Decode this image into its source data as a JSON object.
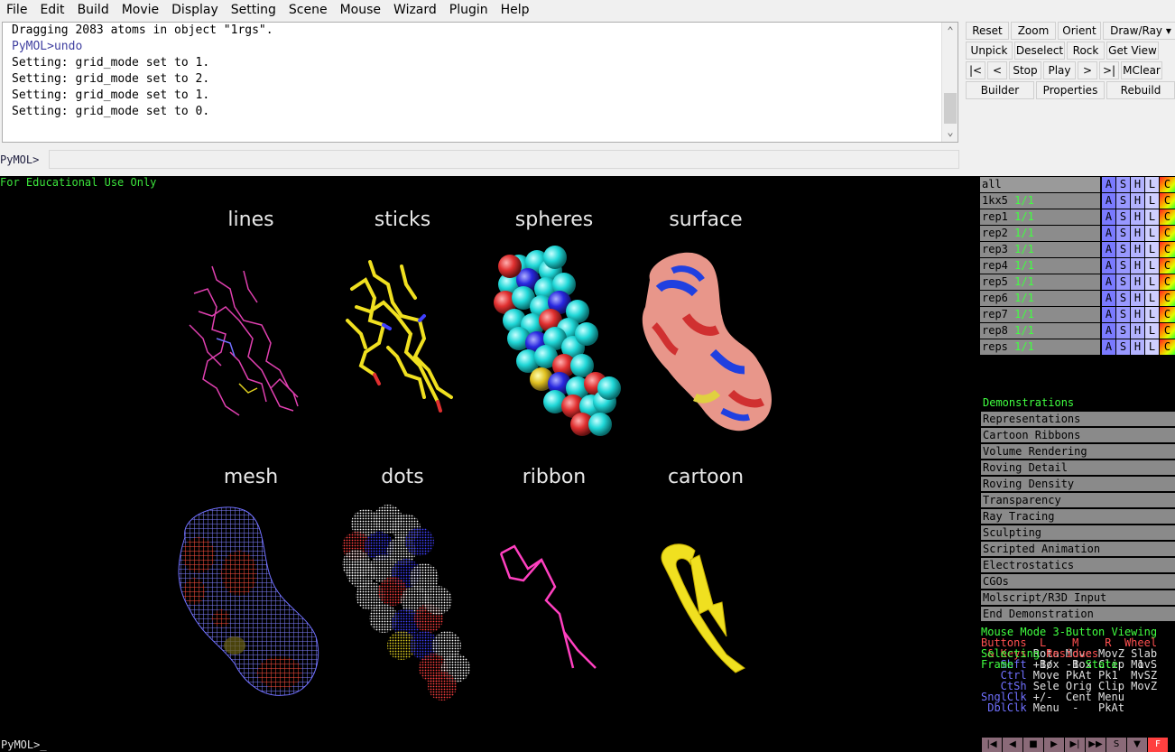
{
  "menubar": {
    "items": [
      "File",
      "Edit",
      "Build",
      "Movie",
      "Display",
      "Setting",
      "Scene",
      "Mouse",
      "Wizard",
      "Plugin",
      "Help"
    ]
  },
  "log": {
    "lines": [
      {
        "text": "Dragging 2083 atoms in object \"1rgs\".",
        "prompt": false
      },
      {
        "text": "PyMOL>undo",
        "prompt": true
      },
      {
        "text": "Setting: grid_mode set to 1.",
        "prompt": false
      },
      {
        "text": "Setting: grid_mode set to 2.",
        "prompt": false
      },
      {
        "text": "Setting: grid_mode set to 1.",
        "prompt": false
      },
      {
        "text": "Setting: grid_mode set to 0.",
        "prompt": false
      }
    ],
    "scroll_up_icon": "triangle-up",
    "scroll_down_icon": "triangle-down"
  },
  "command": {
    "label": "PyMOL>",
    "value": ""
  },
  "buttons": {
    "row1": [
      "Reset",
      "Zoom",
      "Orient",
      "Draw/Ray ▾"
    ],
    "row2": [
      "Unpick",
      "Deselect",
      "Rock",
      "Get View"
    ],
    "row3": [
      "|<",
      "<",
      "Stop",
      "Play",
      ">",
      ">|",
      "MClear"
    ],
    "row4": [
      "Builder",
      "Properties",
      "Rebuild"
    ]
  },
  "viewport": {
    "watermark": "For Educational Use Only",
    "labels": [
      "lines",
      "sticks",
      "spheres",
      "surface",
      "mesh",
      "dots",
      "ribbon",
      "cartoon"
    ]
  },
  "objects": [
    {
      "name": "all",
      "state": ""
    },
    {
      "name": "1kx5",
      "state": "1/1"
    },
    {
      "name": "rep1",
      "state": "1/1"
    },
    {
      "name": "rep2",
      "state": "1/1"
    },
    {
      "name": "rep3",
      "state": "1/1"
    },
    {
      "name": "rep4",
      "state": "1/1"
    },
    {
      "name": "rep5",
      "state": "1/1"
    },
    {
      "name": "rep6",
      "state": "1/1"
    },
    {
      "name": "rep7",
      "state": "1/1"
    },
    {
      "name": "rep8",
      "state": "1/1"
    },
    {
      "name": "reps",
      "state": "1/1"
    }
  ],
  "object_buttons": [
    "A",
    "S",
    "H",
    "L",
    "C"
  ],
  "demos": {
    "header": "Demonstrations",
    "items": [
      "Representations",
      "Cartoon Ribbons",
      "Volume Rendering",
      "Roving Detail",
      "Roving Density",
      "Transparency",
      "Ray Tracing",
      "Sculpting",
      "Scripted Animation",
      "Electrostatics",
      "CGOs",
      "Molscript/R3D Input",
      "End Demonstration"
    ]
  },
  "mouse": {
    "title": "Mouse Mode 3-Button Viewing",
    "rows": [
      {
        "c": "#ff5050",
        "t": "Buttons  L    M    R  Wheel"
      },
      {
        "c": "#ff5050",
        "t": " & Keys ",
        "rest": "Rota Move MovZ Slab"
      },
      {
        "c": "#7070ff",
        "t": "   Shft ",
        "rest": "+Box -Box Clip MovS"
      },
      {
        "c": "#7070ff",
        "t": "   Ctrl ",
        "rest": "Move PkAt Pk1  MvSZ"
      },
      {
        "c": "#7070ff",
        "t": "   CtSh ",
        "rest": "Sele Orig Clip MovZ"
      },
      {
        "c": "#7070ff",
        "t": "SnglClk ",
        "rest": "+/-  Cent Menu"
      },
      {
        "c": "#7070ff",
        "t": " DblClk ",
        "rest": "Menu  -   PkAt"
      }
    ],
    "selecting_label": "Selecting",
    "selecting_value": "Residues",
    "frame_label": "Frame",
    "frame_value": "    1/   1",
    "state_label": "State",
    "state_value": "   1"
  },
  "bottom_command": "PyMOL>_",
  "transport": [
    "|◀",
    "◀",
    "■",
    "▶",
    "▶|",
    "▶▶",
    "S",
    "▼",
    "F"
  ]
}
